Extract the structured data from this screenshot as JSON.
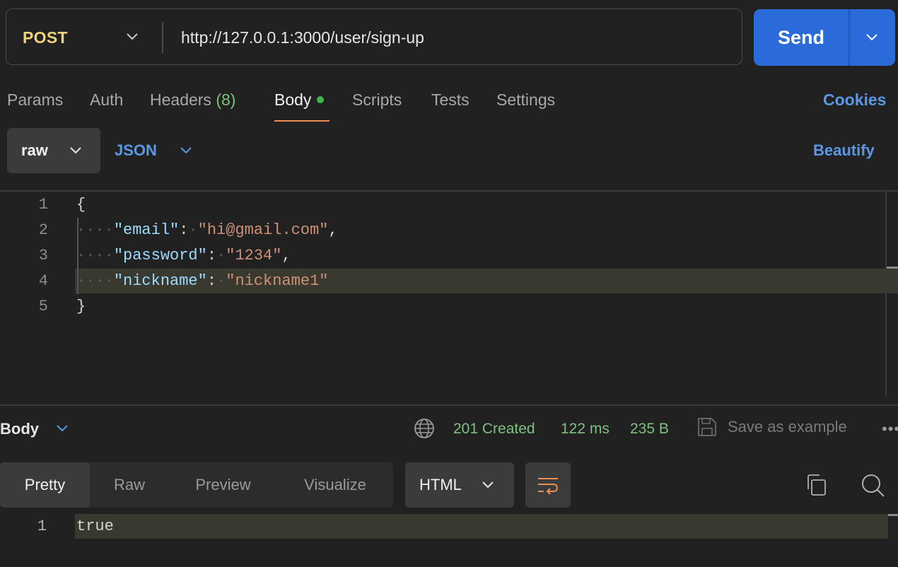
{
  "request": {
    "method": "POST",
    "url": "http://127.0.0.1:3000/user/sign-up",
    "send_label": "Send"
  },
  "tabs": [
    {
      "label": "Params"
    },
    {
      "label": "Auth"
    },
    {
      "label": "Headers",
      "count": "(8)"
    },
    {
      "label": "Body",
      "active": true
    },
    {
      "label": "Scripts"
    },
    {
      "label": "Tests"
    },
    {
      "label": "Settings"
    }
  ],
  "cookies_label": "Cookies",
  "body_options": {
    "mode": "raw",
    "format": "JSON",
    "beautify_label": "Beautify"
  },
  "editor": {
    "line_numbers": [
      "1",
      "2",
      "3",
      "4",
      "5"
    ],
    "lines": {
      "open": "{",
      "close": "}",
      "email_key": "\"email\"",
      "email_value": "\"hi@gmail.com\"",
      "password_key": "\"password\"",
      "password_value": "\"1234\"",
      "nickname_key": "\"nickname\"",
      "nickname_value": "\"nickname1\""
    }
  },
  "response": {
    "section_label": "Body",
    "status": "201 Created",
    "time": "122 ms",
    "size": "235 B",
    "save_label": "Save as example",
    "more_label": "•••",
    "views": [
      "Pretty",
      "Raw",
      "Preview",
      "Visualize"
    ],
    "active_view": "Pretty",
    "format": "HTML",
    "line_number": "1",
    "content": "true"
  },
  "colors": {
    "accent_blue": "#2b6ad9",
    "link_blue": "#5a98e4",
    "method_yellow": "#f0d27a",
    "success_green": "#7fc07f",
    "tab_underline": "#ef8b55"
  }
}
